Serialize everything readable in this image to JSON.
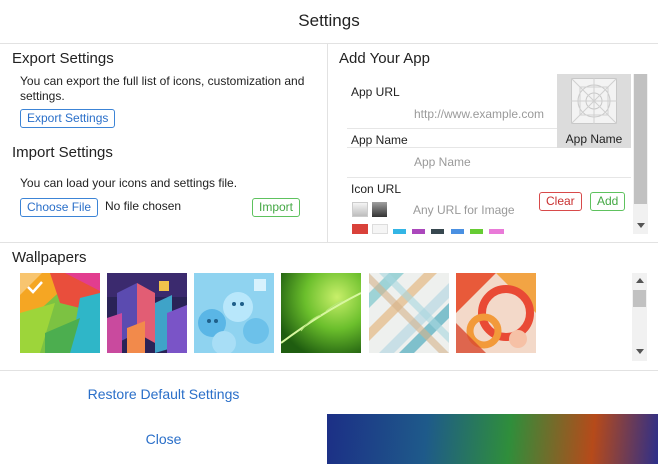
{
  "dialog": {
    "title": "Settings"
  },
  "export": {
    "heading": "Export Settings",
    "description": "You can export the full list of icons, customization and settings.",
    "button_label": "Export Settings"
  },
  "import": {
    "heading": "Import Settings",
    "description": "You can load your icons and settings file.",
    "choose_file_label": "Choose File",
    "file_status": "No file chosen",
    "import_label": "Import"
  },
  "add_app": {
    "heading": "Add Your App",
    "url_label": "App URL",
    "url_placeholder": "http://www.example.com",
    "name_label": "App Name",
    "name_placeholder": "App Name",
    "icon_label": "Icon URL",
    "icon_placeholder": "Any URL for Image",
    "clear_label": "Clear",
    "add_label": "Add",
    "preview_label": "App Name",
    "swatch_colors": [
      "#d9413a",
      "#f5f5f5",
      "#33b5e5",
      "#ab47bc",
      "#37474f",
      "#4a90e2",
      "#66cc33",
      "#e97ad8"
    ]
  },
  "wallpapers": {
    "heading": "Wallpapers",
    "items": [
      {
        "name": "colorful-material",
        "selected": true
      },
      {
        "name": "geometric-city",
        "selected": false
      },
      {
        "name": "blue-characters",
        "selected": false
      },
      {
        "name": "green-leaf",
        "selected": false
      },
      {
        "name": "pastel-diagonals",
        "selected": false
      },
      {
        "name": "orange-circles",
        "selected": false
      }
    ]
  },
  "footer": {
    "restore_label": "Restore Default Settings",
    "close_label": "Close"
  }
}
